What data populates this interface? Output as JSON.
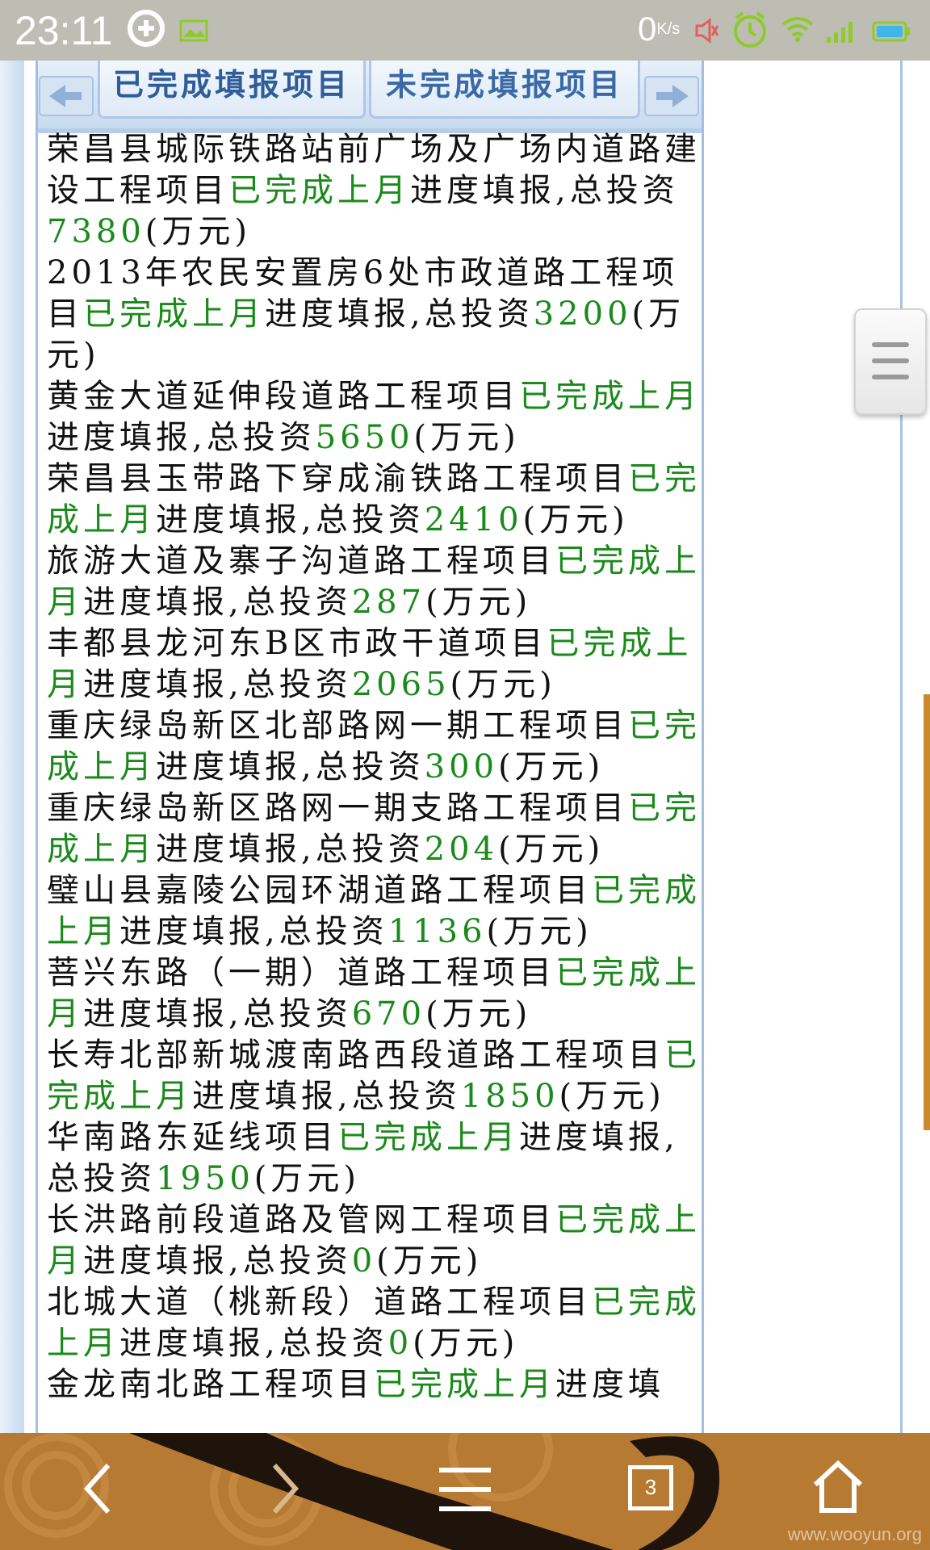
{
  "status_bar": {
    "time": "23:11",
    "data_speed_value": "0",
    "data_speed_unit": "K/s",
    "icons": [
      "sync-plus-icon",
      "image-icon",
      "mute-icon",
      "alarm-icon",
      "wifi-icon",
      "signal-icon",
      "battery-icon"
    ]
  },
  "tabs": {
    "completed": "已完成填报项目",
    "incomplete": "未完成填报项目"
  },
  "list": {
    "status_text": "已完成上月",
    "mid_text": "进度填报,总投资",
    "unit_text": "(万元)",
    "items": [
      {
        "name": "荣昌县城际铁路站前广场及广场内道路建设工程项目",
        "amount": "7380"
      },
      {
        "name": "2013年农民安置房6处市政道路工程项目",
        "amount": "3200"
      },
      {
        "name": "黄金大道延伸段道路工程项目",
        "amount": "5650"
      },
      {
        "name": "荣昌县玉带路下穿成渝铁路工程项目",
        "amount": "2410"
      },
      {
        "name": "旅游大道及寨子沟道路工程项目",
        "amount": "287"
      },
      {
        "name": "丰都县龙河东B区市政干道项目",
        "amount": "2065"
      },
      {
        "name": "重庆绿岛新区北部路网一期工程项目",
        "amount": "300"
      },
      {
        "name": "重庆绿岛新区路网一期支路工程项目",
        "amount": "204"
      },
      {
        "name": "璧山县嘉陵公园环湖道路工程项目",
        "amount": "1136"
      },
      {
        "name": "菩兴东路（一期）道路工程项目",
        "amount": "670"
      },
      {
        "name": "长寿北部新城渡南路西段道路工程项目",
        "amount": "1850"
      },
      {
        "name": "华南路东延线项目",
        "amount": "1950"
      },
      {
        "name": "长洪路前段道路及管网工程项目",
        "amount": "0"
      },
      {
        "name": "北城大道（桃新段）道路工程项目",
        "amount": "0"
      },
      {
        "name": "金龙南北路工程项目",
        "amount": ""
      }
    ],
    "last_item_suffix": "进度填"
  },
  "bottom_nav": {
    "tab_count": "3",
    "watermark": "www.wooyun.org"
  },
  "colors": {
    "status_green": "#1a8a1a",
    "tab_text": "#2f5d99",
    "status_bar_bg": "#bdbdb3",
    "nav_bg": "#b77a33"
  }
}
